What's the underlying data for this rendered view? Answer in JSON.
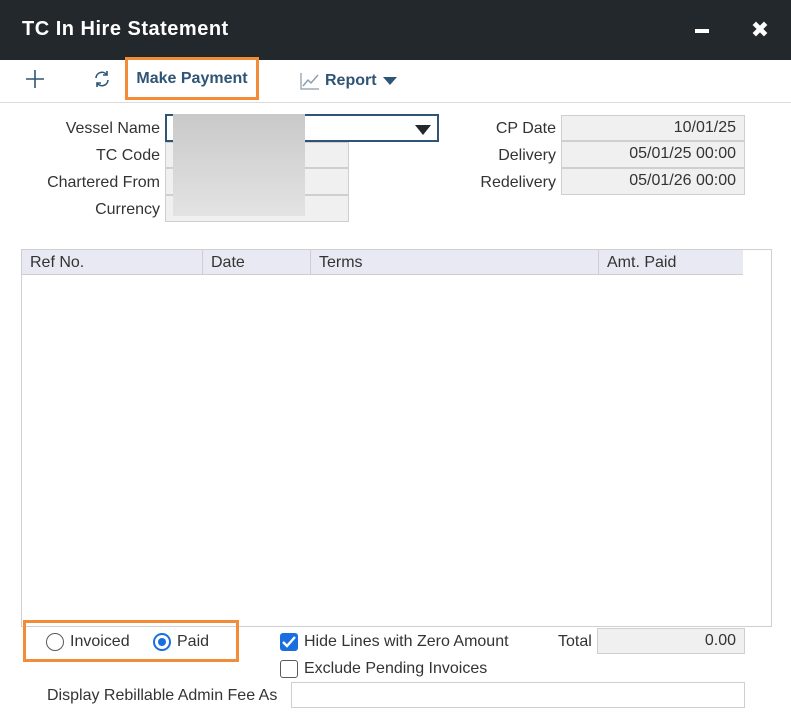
{
  "window": {
    "title": "TC In Hire Statement"
  },
  "toolbar": {
    "make_payment_label": "Make Payment",
    "report_label": "Report"
  },
  "form": {
    "vessel_name_label": "Vessel Name",
    "tc_code_label": "TC Code",
    "chartered_from_label": "Chartered From",
    "currency_label": "Currency",
    "cp_date_label": "CP Date",
    "cp_date_value": "10/01/25",
    "delivery_label": "Delivery",
    "delivery_value": "05/01/25 00:00",
    "redelivery_label": "Redelivery",
    "redelivery_value": "05/01/26 00:00"
  },
  "grid": {
    "columns": [
      "Ref No.",
      "Date",
      "Terms",
      "Amt. Paid"
    ]
  },
  "filters": {
    "invoiced_label": "Invoiced",
    "paid_label": "Paid",
    "selected": "Paid",
    "hide_zero_label": "Hide Lines with Zero Amount",
    "hide_zero_checked": true,
    "exclude_pending_label": "Exclude Pending Invoices",
    "exclude_pending_checked": false
  },
  "summary": {
    "total_label": "Total",
    "total_value": "0.00"
  },
  "admin_fee": {
    "label": "Display Rebillable Admin Fee As",
    "value": ""
  },
  "colors": {
    "titlebar": "#23282c",
    "accent": "#2f5576",
    "highlight": "#f28c38",
    "control_blue": "#1a6fe0"
  },
  "icons": [
    "plus-icon",
    "refresh-icon",
    "chart-icon",
    "caret-down-icon",
    "minimize-icon",
    "close-icon"
  ]
}
